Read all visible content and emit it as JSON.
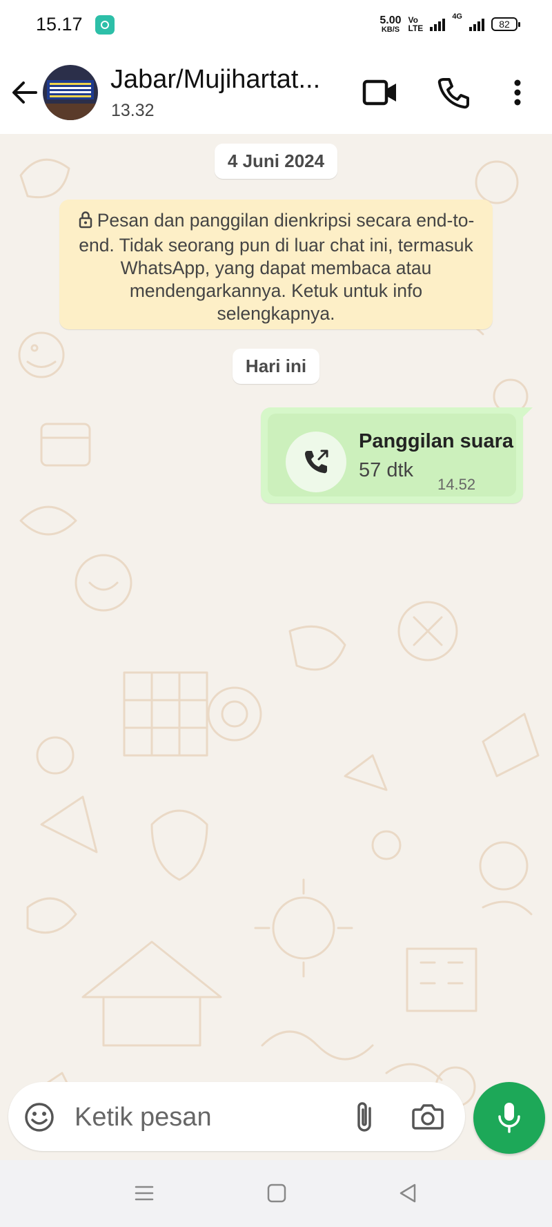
{
  "status_bar": {
    "time": "15.17",
    "net_speed": "5.00",
    "net_speed_unit": "KB/S",
    "volte_top": "Vo",
    "volte_bottom": "LTE",
    "network_type": "4G",
    "battery": "82"
  },
  "header": {
    "contact_name": "Jabar/Mujihartat...",
    "contact_status": "13.32"
  },
  "chat": {
    "date_chip": "4 Juni 2024",
    "encryption_notice": "Pesan dan panggilan dienkripsi secara end-to-end. Tidak seorang pun di luar chat ini, termasuk WhatsApp, yang dapat membaca atau mendengarkannya. Ketuk untuk info selengkapnya.",
    "today_chip": "Hari ini",
    "call_message": {
      "title": "Panggilan suara",
      "duration": "57 dtk",
      "time": "14.52"
    }
  },
  "composer": {
    "placeholder": "Ketik pesan"
  },
  "colors": {
    "accent_green": "#1da858",
    "bubble_out": "#d6f7c9",
    "notice_bg": "#fdefc7",
    "chat_bg": "#f5f1eb"
  }
}
